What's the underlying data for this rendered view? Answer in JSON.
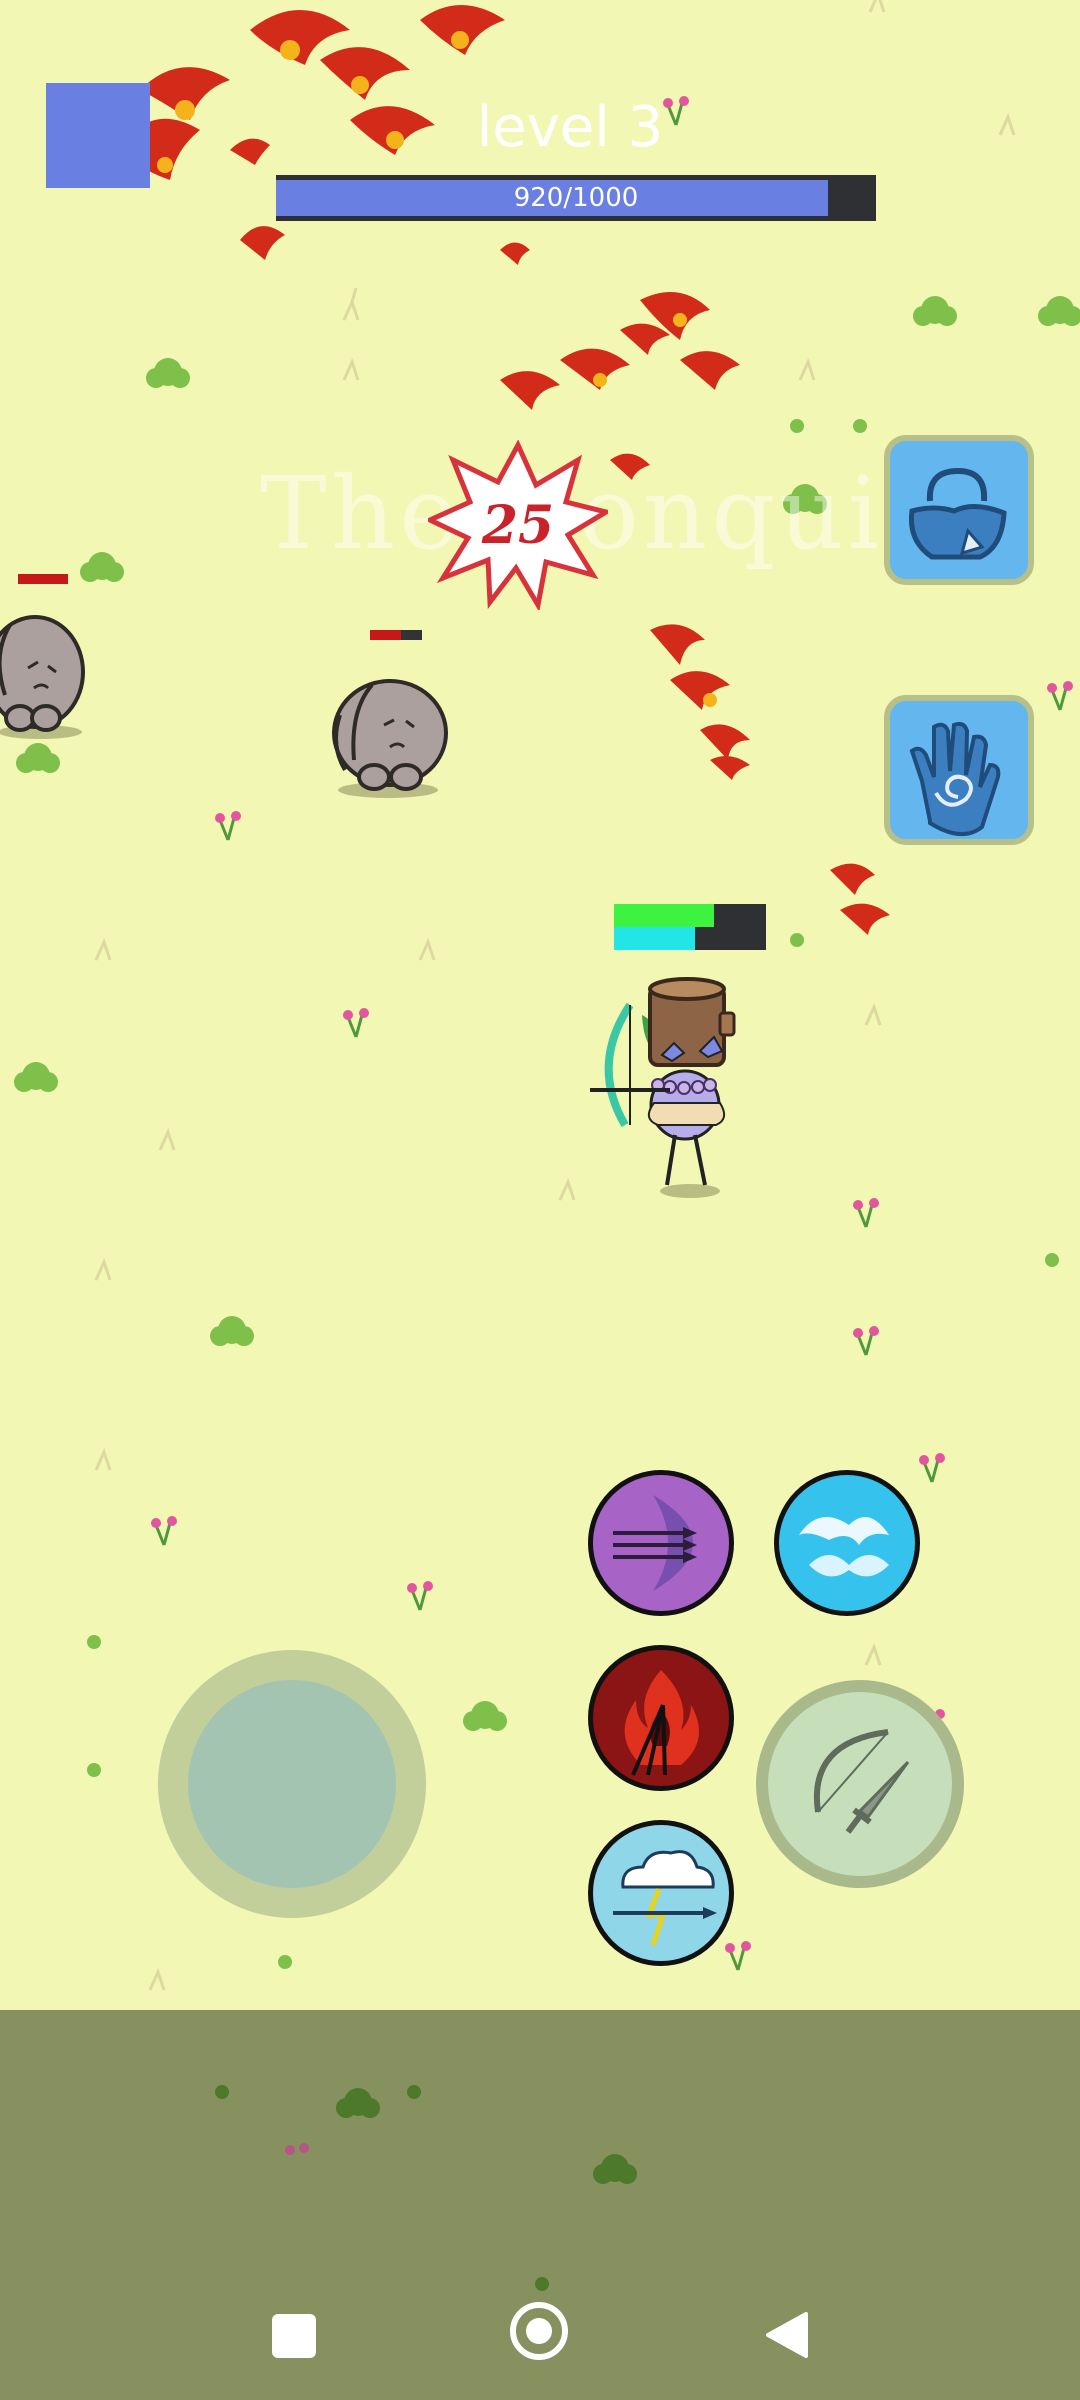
{
  "hud": {
    "level_label": "level 3",
    "xp_text": "920/1000",
    "xp_current": 920,
    "xp_max": 1000,
    "xp_color": "#6a7fe2",
    "menu_color": "#6a7fe2"
  },
  "watermark": "The Conquis",
  "damage_popup": "25",
  "player": {
    "health_fraction": 0.66,
    "mana_fraction": 0.53,
    "health_color": "#3ef240",
    "mana_color": "#22e6e6"
  },
  "enemies": [
    {
      "name": "rabbit",
      "health_fraction": 1.0
    },
    {
      "name": "rabbit",
      "health_fraction": 0.6
    }
  ],
  "side_buttons": [
    {
      "icon": "bag-icon"
    },
    {
      "icon": "hand-spiral-icon"
    }
  ],
  "skills": [
    {
      "icon": "multi-arrow-icon",
      "color": "#a763c6"
    },
    {
      "icon": "water-wave-icon",
      "color": "#35c3ee"
    },
    {
      "icon": "fire-arrow-icon",
      "color": "#8b1414"
    },
    {
      "icon": "storm-arrow-icon",
      "color": "#8ed6e8"
    }
  ],
  "attack_button": {
    "icon": "bow-sword-icon"
  },
  "navigation": {
    "recent_icon": "square-icon",
    "home_icon": "circle-icon",
    "back_icon": "triangle-icon"
  }
}
